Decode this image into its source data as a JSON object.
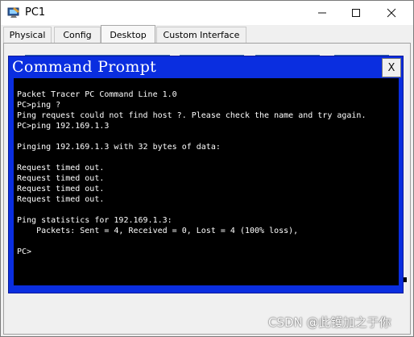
{
  "window": {
    "title": "PC1",
    "icon": "pc-icon",
    "controls": {
      "minimize": "—",
      "maximize": "☐",
      "close": "✕"
    }
  },
  "tabs": [
    {
      "label": "Physical",
      "active": false
    },
    {
      "label": "Config",
      "active": false
    },
    {
      "label": "Desktop",
      "active": true
    },
    {
      "label": "Custom Interface",
      "active": false
    }
  ],
  "command_prompt": {
    "title": "Command Prompt",
    "close_label": "X",
    "lines": [
      "Packet Tracer PC Command Line 1.0",
      "PC>ping ?",
      "Ping request could not find host ?. Please check the name and try again.",
      "PC>ping 192.169.1.3",
      "",
      "Pinging 192.169.1.3 with 32 bytes of data:",
      "",
      "Request timed out.",
      "Request timed out.",
      "Request timed out.",
      "Request timed out.",
      "",
      "Ping statistics for 192.169.1.3:",
      "    Packets: Sent = 4, Received = 0, Lost = 4 (100% loss),",
      "",
      "PC>"
    ]
  },
  "watermark": "CSDN @此镬加之于你",
  "colors": {
    "cmd_title_bar": "#0a2ee0",
    "terminal_bg": "#000000",
    "terminal_text": "#ffffff"
  }
}
